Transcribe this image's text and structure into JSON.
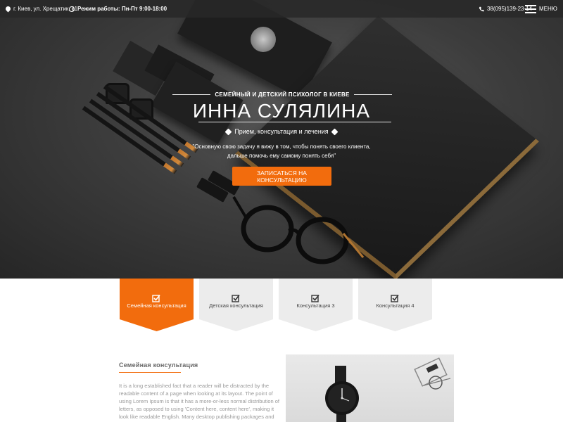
{
  "topbar": {
    "address": "г. Киев, ул. Хрещатик, 11",
    "hours": "Режим работы: Пн-Пт 9:00-18:00",
    "phone": "38(095)139-23-14",
    "menu_label": "МЕНЮ"
  },
  "hero": {
    "subtitle": "СЕМЕЙНЫЙ И ДЕТСКИЙ ПСИХОЛОГ В КИЕВЕ",
    "name": "ИННА СУЛЯЛИНА",
    "services": "Прием, консультация и лечения",
    "quote_line1": "\"Основную свою задачу я вижу в том, чтобы понять своего клиента,",
    "quote_line2": "дальше помочь ему самому понять себя\"",
    "cta": "ЗАПИСАТЬСЯ НА КОНСУЛЬТАЦИЮ"
  },
  "tabs": [
    {
      "label": "Семейная консультация",
      "active": true
    },
    {
      "label": "Детская консультация",
      "active": false
    },
    {
      "label": "Консультация 3",
      "active": false
    },
    {
      "label": "Консультация 4",
      "active": false
    }
  ],
  "content": {
    "title": "Семейная консультация",
    "body": "It is a long established fact that a reader will be distracted by the readable content of a page when looking at its layout. The point of using Lorem Ipsum is that it has a more-or-less normal distribution of letters, as opposed to using 'Content here, content here', making it look like readable English. Many desktop publishing packages and web page editors now use Lorem Ipsum as their default model text, and a search for 'lorem ipsum'"
  },
  "colors": {
    "accent": "#f26c0d",
    "tab_inactive": "#ececec",
    "hero_dark": "#2b2b2b",
    "body_text": "#9a9a9a"
  },
  "icons": {
    "address": "map-pin-icon",
    "hours": "clock-icon",
    "phone": "phone-icon",
    "menu": "hamburger-icon",
    "services_left": "tag-icon",
    "services_right": "tags-icon",
    "tab": "checkbox-icon"
  }
}
